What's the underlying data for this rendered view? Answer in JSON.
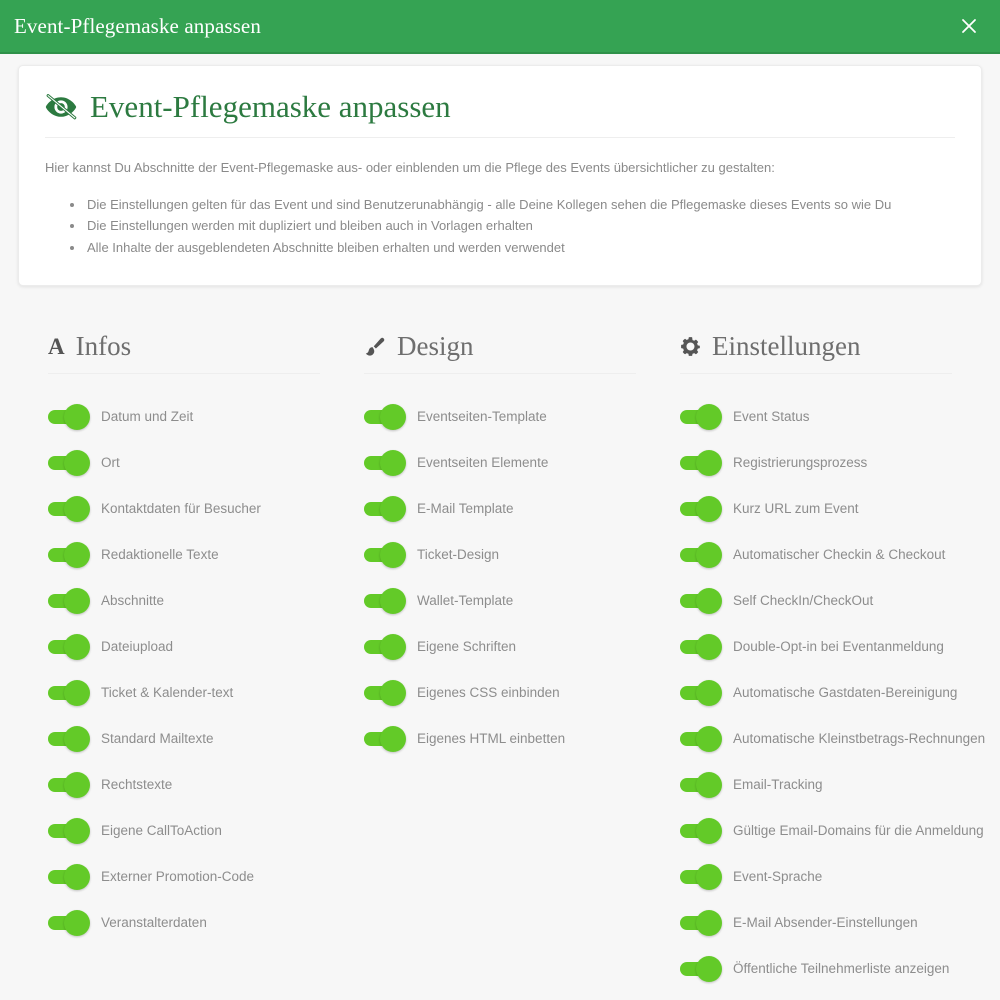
{
  "window": {
    "title": "Event-Pflegemaske anpassen",
    "close_label": "×",
    "header_color": "#35a353",
    "accent_green": "#63ca28",
    "heading_green": "#2c7a40"
  },
  "card": {
    "icon": "eye-slash-icon",
    "heading": "Event-Pflegemaske anpassen",
    "description": "Hier kannst Du Abschnitte der Event-Pflegemaske aus- oder einblenden um die Pflege des Events übersichtlicher zu gestalten:",
    "bullets": [
      "Die Einstellungen gelten für das Event und sind Benutzerunabhängig - alle Deine Kollegen sehen die Pflegemaske dieses Events so wie Du",
      "Die Einstellungen werden mit dupliziert und bleiben auch in Vorlagen erhalten",
      "Alle Inhalte der ausgeblendeten Abschnitte bleiben erhalten und werden verwendet"
    ]
  },
  "columns": [
    {
      "icon": "font-a-icon",
      "title": "Infos",
      "items": [
        {
          "label": "Datum und Zeit",
          "on": true
        },
        {
          "label": "Ort",
          "on": true
        },
        {
          "label": "Kontaktdaten für Besucher",
          "on": true
        },
        {
          "label": "Redaktionelle Texte",
          "on": true
        },
        {
          "label": "Abschnitte",
          "on": true
        },
        {
          "label": "Dateiupload",
          "on": true
        },
        {
          "label": "Ticket & Kalender-text",
          "on": true
        },
        {
          "label": "Standard Mailtexte",
          "on": true
        },
        {
          "label": "Rechtstexte",
          "on": true
        },
        {
          "label": "Eigene CallToAction",
          "on": true
        },
        {
          "label": "Externer Promotion-Code",
          "on": true
        },
        {
          "label": "Veranstalterdaten",
          "on": true
        }
      ]
    },
    {
      "icon": "paintbrush-icon",
      "title": "Design",
      "items": [
        {
          "label": "Eventseiten-Template",
          "on": true
        },
        {
          "label": "Eventseiten Elemente",
          "on": true
        },
        {
          "label": "E-Mail Template",
          "on": true
        },
        {
          "label": "Ticket-Design",
          "on": true
        },
        {
          "label": "Wallet-Template",
          "on": true
        },
        {
          "label": "Eigene Schriften",
          "on": true
        },
        {
          "label": "Eigenes CSS einbinden",
          "on": true
        },
        {
          "label": "Eigenes HTML einbetten",
          "on": true
        }
      ]
    },
    {
      "icon": "gear-icon",
      "title": "Einstellungen",
      "items": [
        {
          "label": "Event Status",
          "on": true
        },
        {
          "label": "Registrierungsprozess",
          "on": true
        },
        {
          "label": "Kurz URL zum Event",
          "on": true
        },
        {
          "label": "Automatischer Checkin & Checkout",
          "on": true
        },
        {
          "label": "Self CheckIn/CheckOut",
          "on": true
        },
        {
          "label": "Double-Opt-in bei Eventanmeldung",
          "on": true
        },
        {
          "label": "Automatische Gastdaten-Bereinigung",
          "on": true
        },
        {
          "label": "Automatische Kleinstbetrags-Rechnungen",
          "on": true
        },
        {
          "label": "Email-Tracking",
          "on": true
        },
        {
          "label": "Gültige Email-Domains für die Anmeldung",
          "on": true
        },
        {
          "label": "Event-Sprache",
          "on": true
        },
        {
          "label": "E-Mail Absender-Einstellungen",
          "on": true
        },
        {
          "label": "Öffentliche Teilnehmerliste anzeigen",
          "on": true
        }
      ]
    }
  ]
}
